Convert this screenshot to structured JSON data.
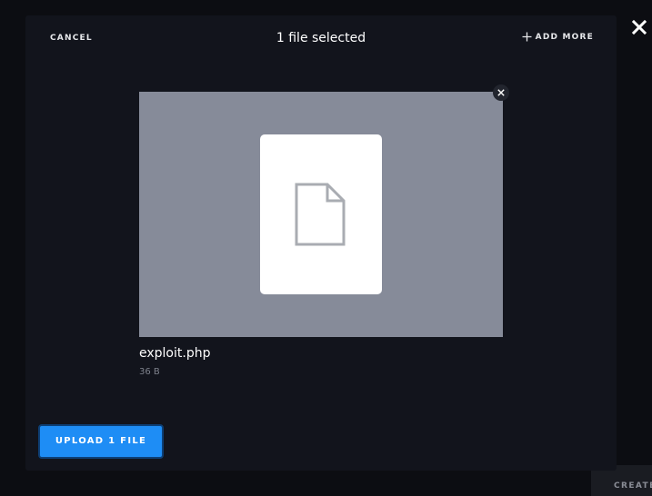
{
  "background": {
    "create_label": "CREATE"
  },
  "modal": {
    "cancel_label": "CANCEL",
    "title": "1 file selected",
    "add_more_label": "ADD MORE",
    "upload_label": "UPLOAD 1 FILE"
  },
  "file": {
    "name": "exploit.php",
    "size": "36 B"
  },
  "icons": {
    "close_modal": "close-icon",
    "add_more": "plus-icon",
    "remove_file": "close-icon",
    "file": "document-icon"
  },
  "colors": {
    "accent": "#1e8df5",
    "modal_bg": "#12141c",
    "preview_bg": "#868b99"
  }
}
